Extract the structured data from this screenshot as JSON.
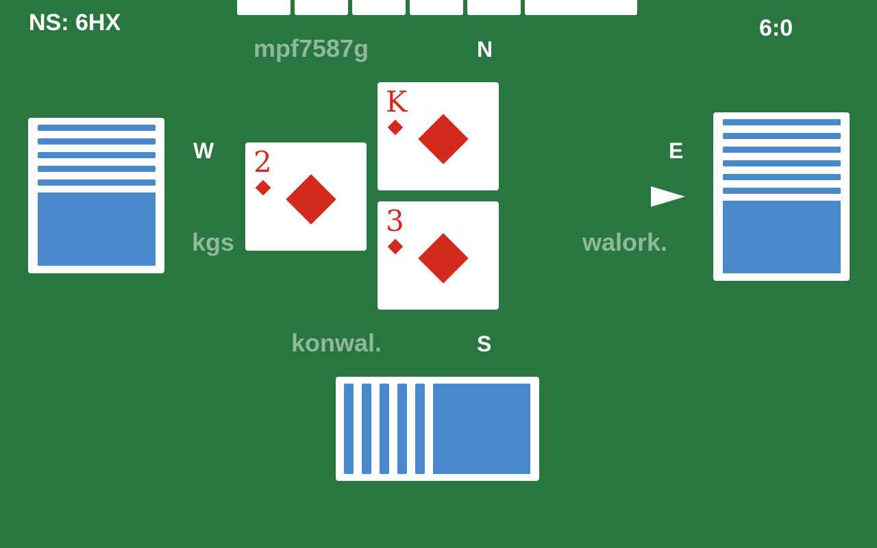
{
  "contract": "NS: 6HX",
  "score": "6:0",
  "seats": {
    "north": "N",
    "west": "W",
    "east": "E",
    "south": "S"
  },
  "players": {
    "north": "mpf7587g",
    "west": "kgs",
    "east": "walork.",
    "south": "konwal."
  },
  "trick": [
    {
      "position": "west",
      "rank": "2",
      "suit": "diamonds"
    },
    {
      "position": "north",
      "rank": "K",
      "suit": "diamonds"
    },
    {
      "position": "south",
      "rank": "3",
      "suit": "diamonds"
    }
  ],
  "turn_indicator": "east",
  "colors": {
    "table": "#2a7641",
    "card_back": "#4a89cc",
    "suit_red": "#d42a1e"
  }
}
